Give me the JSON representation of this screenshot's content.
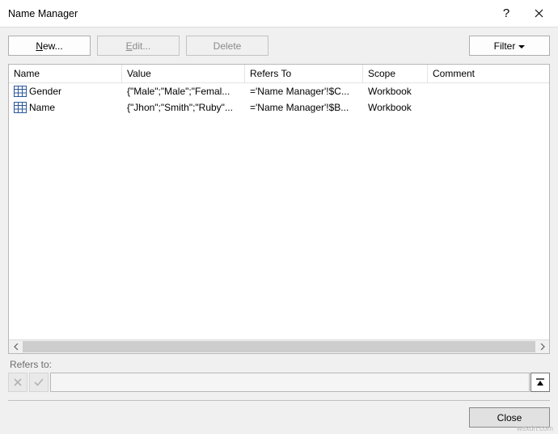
{
  "title": "Name Manager",
  "toolbar": {
    "new_prefix": "N",
    "new_suffix": "ew...",
    "edit_prefix": "E",
    "edit_suffix": "dit...",
    "delete_label": "Delete",
    "filter_label": "Filter"
  },
  "columns": {
    "name": "Name",
    "value": "Value",
    "refers": "Refers To",
    "scope": "Scope",
    "comment": "Comment"
  },
  "rows": [
    {
      "name": "Gender",
      "value": "{\"Male\";\"Male\";\"Femal...",
      "refers": "='Name Manager'!$C...",
      "scope": "Workbook",
      "comment": ""
    },
    {
      "name": "Name",
      "value": "{\"Jhon\";\"Smith\";\"Ruby\"...",
      "refers": "='Name Manager'!$B...",
      "scope": "Workbook",
      "comment": ""
    }
  ],
  "refers_section": {
    "label": "Refers to:",
    "value": ""
  },
  "footer": {
    "close_label": "Close"
  },
  "attribution": "wsxdn.com"
}
